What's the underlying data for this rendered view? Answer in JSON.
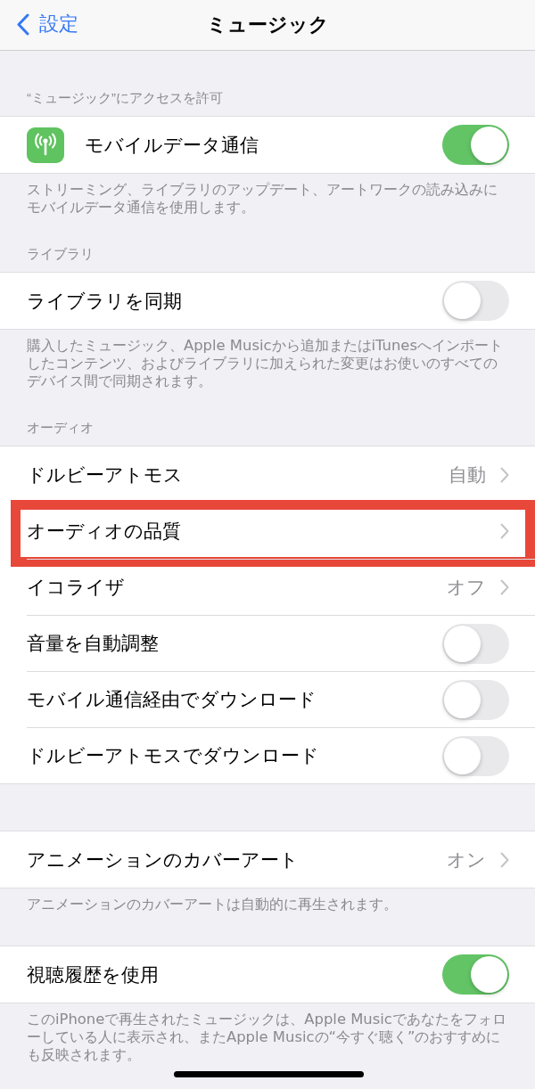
{
  "nav": {
    "back_label": "設定",
    "title": "ミュージック"
  },
  "sections": [
    {
      "header": "“ミュージック”にアクセスを許可",
      "rows": [
        {
          "kind": "app_toggle",
          "label": "モバイルデータ通信",
          "on": true,
          "highlighted": false
        }
      ],
      "footer": "ストリーミング、ライブラリのアップデート、アートワークの読み込みにモバイルデータ通信を使用します。"
    },
    {
      "header": "ライブラリ",
      "rows": [
        {
          "kind": "toggle",
          "label": "ライブラリを同期",
          "on": false,
          "highlighted": false
        }
      ],
      "footer": "購入したミュージック、Apple Musicから追加またはiTunesへインポートしたコンテンツ、およびライブラリに加えられた変更はお使いのすべてのデバイス間で同期されます。"
    },
    {
      "header": "オーディオ",
      "rows": [
        {
          "kind": "link",
          "label": "ドルビーアトモス",
          "value": "自動",
          "highlighted": false
        },
        {
          "kind": "link",
          "label": "オーディオの品質",
          "highlighted": true
        },
        {
          "kind": "link",
          "label": "イコライザ",
          "value": "オフ",
          "highlighted": false
        },
        {
          "kind": "toggle",
          "label": "音量を自動調整",
          "on": false,
          "highlighted": false
        },
        {
          "kind": "toggle",
          "label": "モバイル通信経由でダウンロード",
          "on": false,
          "highlighted": false
        },
        {
          "kind": "toggle",
          "label": "ドルビーアトモスでダウンロード",
          "on": false,
          "highlighted": false
        }
      ]
    },
    {
      "rows": [
        {
          "kind": "link",
          "label": "アニメーションのカバーアート",
          "value": "オン",
          "highlighted": false
        }
      ],
      "footer": "アニメーションのカバーアートは自動的に再生されます。"
    },
    {
      "rows": [
        {
          "kind": "toggle",
          "label": "視聴履歴を使用",
          "on": true,
          "highlighted": false
        }
      ],
      "footer": "このiPhoneで再生されたミュージックは、Apple Musicであなたをフォローしている人に表示され、またApple Musicの“今すぐ聴く”のおすすめにも反映されます。"
    }
  ]
}
